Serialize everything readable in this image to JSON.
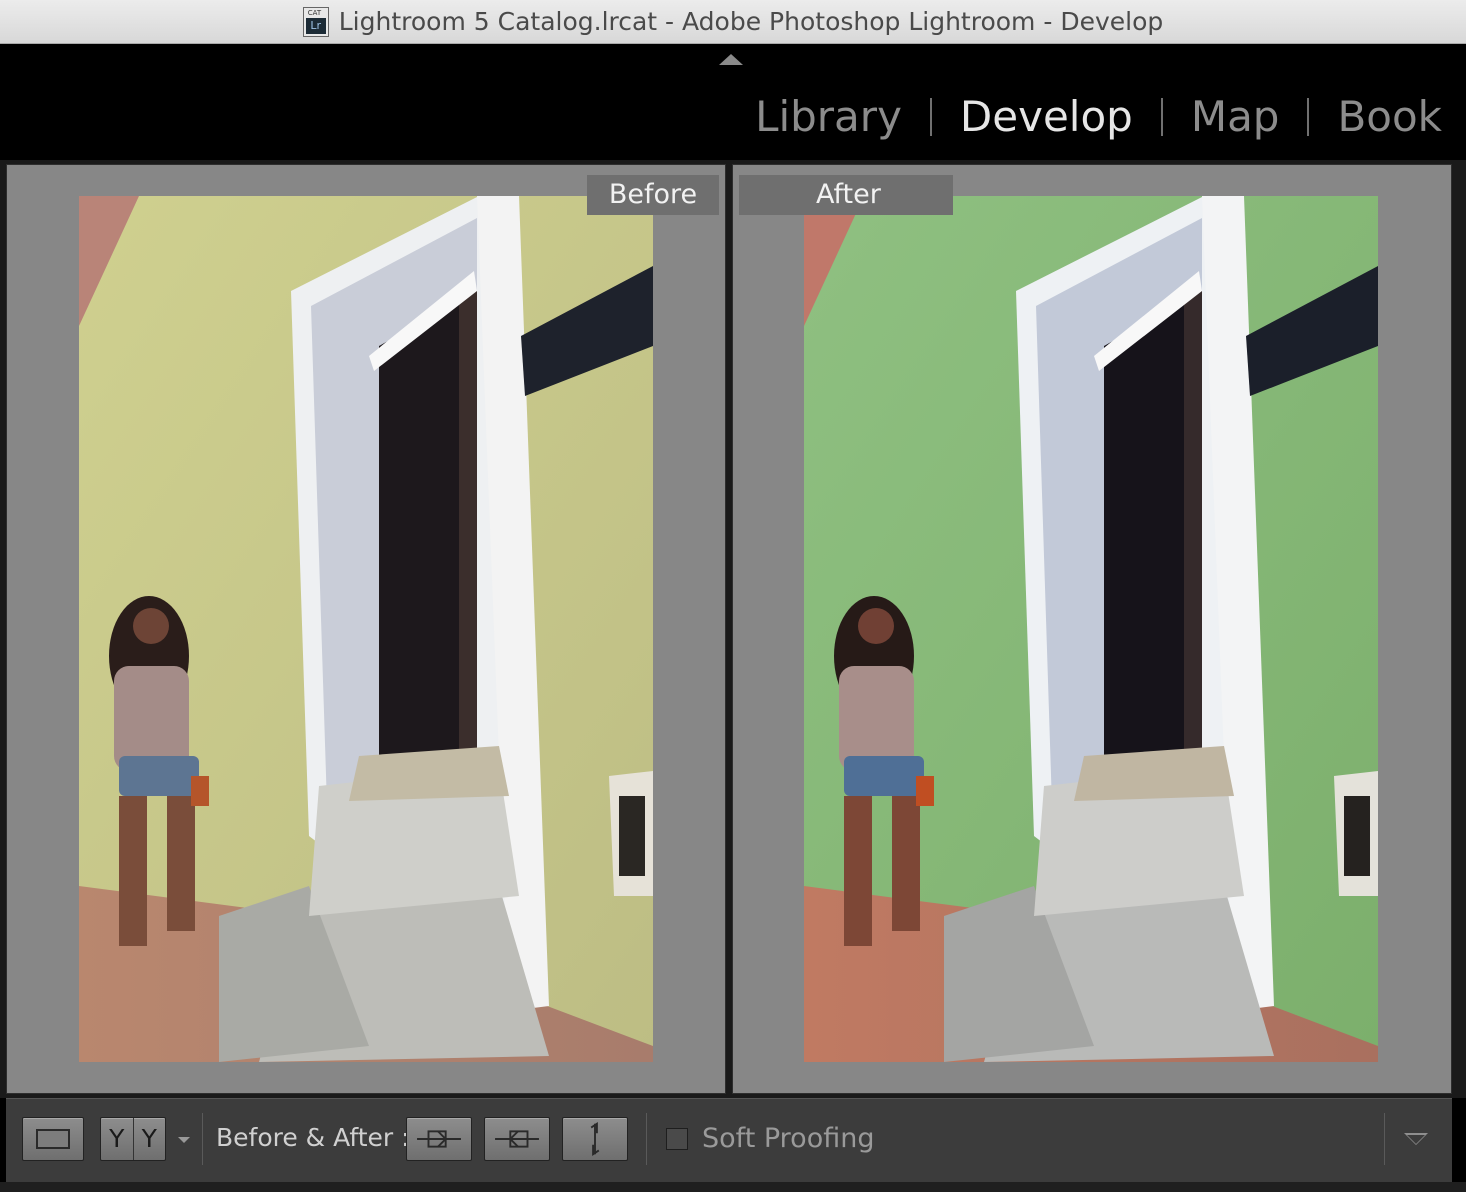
{
  "window": {
    "title": "Lightroom 5 Catalog.lrcat - Adobe Photoshop Lightroom - Develop",
    "file_icon": "lrcat-file-icon",
    "file_icon_ext": "CAT",
    "file_icon_badge": "Lr"
  },
  "modules": {
    "items": [
      {
        "label": "Library",
        "active": false
      },
      {
        "label": "Develop",
        "active": true
      },
      {
        "label": "Map",
        "active": false
      },
      {
        "label": "Book",
        "active": false
      }
    ]
  },
  "panes": {
    "before_label": "Before",
    "after_label": "After"
  },
  "toolbar": {
    "view_yy_left": "Y",
    "view_yy_right": "Y",
    "before_after_label": "Before & After :",
    "soft_proofing_label": "Soft Proofing",
    "soft_proofing_checked": false
  },
  "colors": {
    "active_module": "#e6e6e6",
    "inactive_module": "#8c8c8c",
    "pane_background": "#878787",
    "before_wall": "#c9c98a",
    "after_wall": "#86b874"
  }
}
